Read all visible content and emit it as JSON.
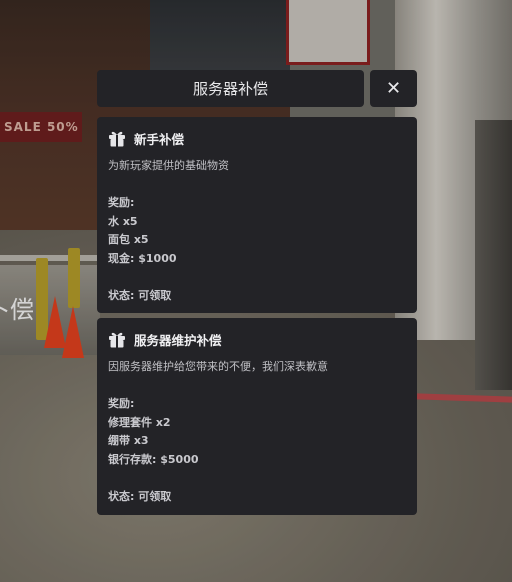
{
  "header": {
    "title": "服务器补偿",
    "close_symbol": "✕"
  },
  "background": {
    "shop_sign_text": "SALE 50%",
    "overlay_text": "卜偿"
  },
  "cards": [
    {
      "icon": "gift-icon",
      "title": "新手补偿",
      "description": "为新玩家提供的基础物资",
      "rewards_label": "奖励:",
      "rewards": [
        "水 x5",
        "面包 x5",
        "现金: $1000"
      ],
      "status": "状态: 可领取"
    },
    {
      "icon": "gift-icon",
      "title": "服务器维护补偿",
      "description": "因服务器维护给您带来的不便，我们深表歉意",
      "rewards_label": "奖励:",
      "rewards": [
        "修理套件 x2",
        "绷带 x3",
        "银行存款: $5000"
      ],
      "status": "状态: 可领取"
    }
  ],
  "colors": {
    "panel_bg": "#232327",
    "title_text": "#f0f0f2",
    "body_text": "#c6c6cb"
  }
}
